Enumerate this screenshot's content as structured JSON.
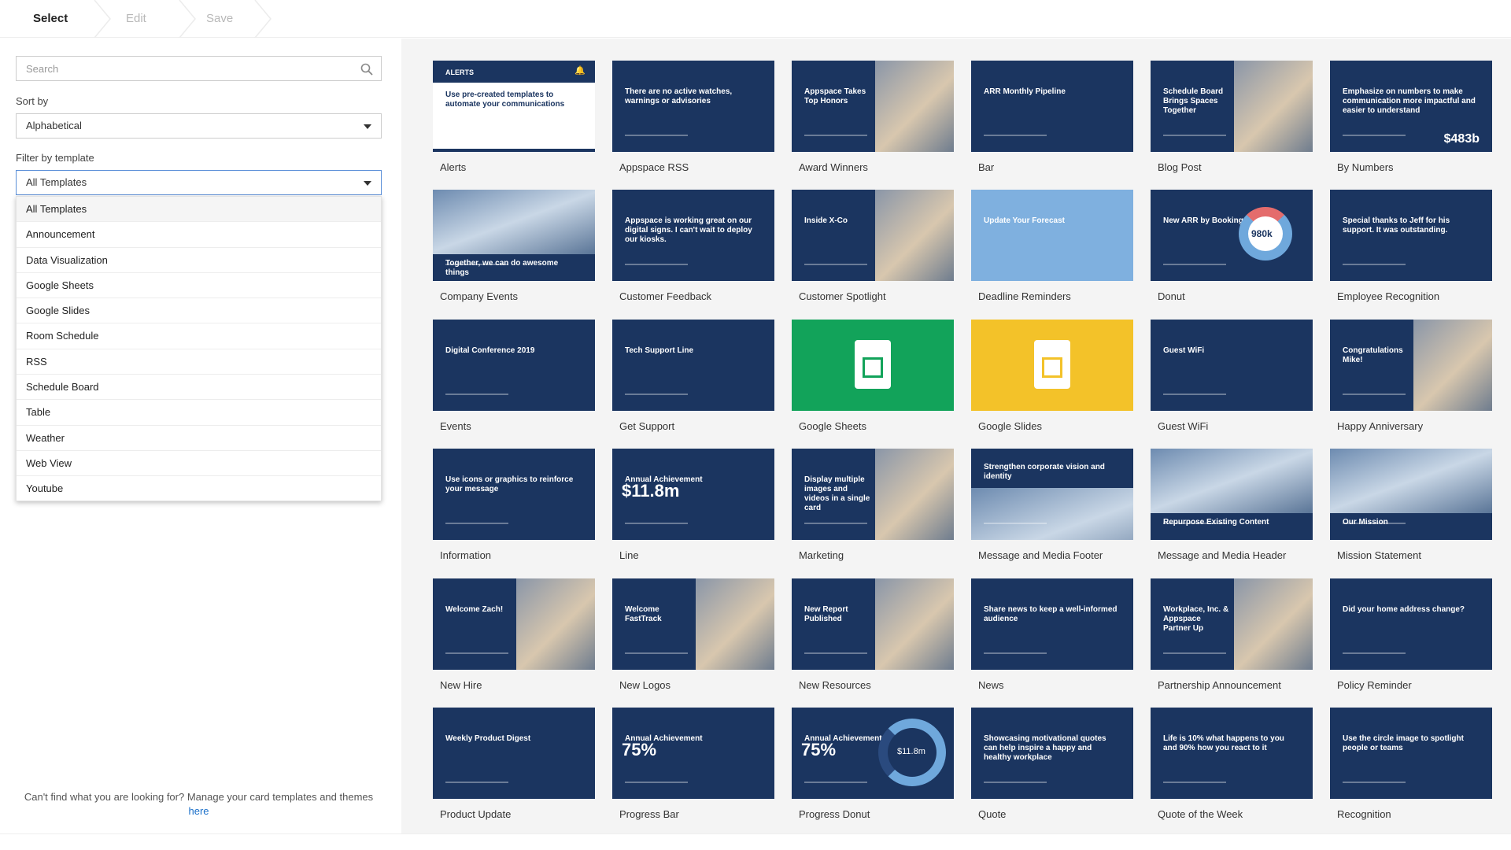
{
  "stepper": {
    "steps": [
      "Select",
      "Edit",
      "Save"
    ]
  },
  "search": {
    "placeholder": "Search"
  },
  "sort": {
    "label": "Sort by",
    "value": "Alphabetical"
  },
  "filter": {
    "label": "Filter by template",
    "value": "All Templates",
    "options": [
      "All Templates",
      "Announcement",
      "Data Visualization",
      "Google Sheets",
      "Google Slides",
      "Room Schedule",
      "RSS",
      "Schedule Board",
      "Table",
      "Weather",
      "Web View",
      "Youtube"
    ]
  },
  "footer": {
    "text": "Can't find what you are looking for? Manage your card templates and themes",
    "link": "here"
  },
  "templates": [
    {
      "name": "Alerts",
      "thumb": {
        "title": "Use pre-created templates to automate your communications",
        "header": "ALERTS"
      }
    },
    {
      "name": "Appspace RSS",
      "thumb": {
        "title": "There are no active watches, warnings or advisories"
      }
    },
    {
      "name": "Award Winners",
      "thumb": {
        "title": "Appspace Takes Top Honors"
      }
    },
    {
      "name": "Bar",
      "thumb": {
        "title": "ARR Monthly Pipeline"
      }
    },
    {
      "name": "Blog Post",
      "thumb": {
        "title": "Schedule Board Brings Spaces Together"
      }
    },
    {
      "name": "By Numbers",
      "thumb": {
        "title": "Emphasize on numbers to make communication more impactful and easier to understand",
        "big": "$483b"
      }
    },
    {
      "name": "Company Events",
      "thumb": {
        "title": "Together, we can do awesome things"
      }
    },
    {
      "name": "Customer Feedback",
      "thumb": {
        "title": "Appspace is working great on our digital signs. I can't wait to deploy our kiosks."
      }
    },
    {
      "name": "Customer Spotlight",
      "thumb": {
        "title": "Inside X-Co"
      }
    },
    {
      "name": "Deadline Reminders",
      "thumb": {
        "title": "Update Your Forecast"
      }
    },
    {
      "name": "Donut",
      "thumb": {
        "title": "New ARR by Booking Type",
        "big": "980k"
      }
    },
    {
      "name": "Employee Recognition",
      "thumb": {
        "title": "Special thanks to Jeff for his support. It was outstanding."
      }
    },
    {
      "name": "Events",
      "thumb": {
        "title": "Digital Conference 2019"
      }
    },
    {
      "name": "Get Support",
      "thumb": {
        "title": "Tech Support Line"
      }
    },
    {
      "name": "Google Sheets",
      "thumb": {
        "title": ""
      }
    },
    {
      "name": "Google Slides",
      "thumb": {
        "title": ""
      }
    },
    {
      "name": "Guest WiFi",
      "thumb": {
        "title": "Guest WiFi"
      }
    },
    {
      "name": "Happy Anniversary",
      "thumb": {
        "title": "Congratulations Mike!"
      }
    },
    {
      "name": "Information",
      "thumb": {
        "title": "Use icons or graphics to reinforce your message"
      }
    },
    {
      "name": "Line",
      "thumb": {
        "title": "Annual Achievement",
        "big": "$11.8m"
      }
    },
    {
      "name": "Marketing",
      "thumb": {
        "title": "Display multiple images and videos in a single card"
      }
    },
    {
      "name": "Message and Media Footer",
      "thumb": {
        "title": "Strengthen corporate vision and identity"
      }
    },
    {
      "name": "Message and Media Header",
      "thumb": {
        "title": "Repurpose Existing Content"
      }
    },
    {
      "name": "Mission Statement",
      "thumb": {
        "title": "Our Mission"
      }
    },
    {
      "name": "New Hire",
      "thumb": {
        "title": "Welcome Zach!"
      }
    },
    {
      "name": "New Logos",
      "thumb": {
        "title": "Welcome FastTrack"
      }
    },
    {
      "name": "New Resources",
      "thumb": {
        "title": "New Report Published"
      }
    },
    {
      "name": "News",
      "thumb": {
        "title": "Share news to keep a well-informed audience"
      }
    },
    {
      "name": "Partnership Announcement",
      "thumb": {
        "title": "Workplace, Inc. & Appspace Partner Up"
      }
    },
    {
      "name": "Policy Reminder",
      "thumb": {
        "title": "Did your home address change?"
      }
    },
    {
      "name": "Product Update",
      "thumb": {
        "title": "Weekly Product Digest"
      }
    },
    {
      "name": "Progress Bar",
      "thumb": {
        "title": "Annual Achievement",
        "big": "75%"
      }
    },
    {
      "name": "Progress Donut",
      "thumb": {
        "title": "Annual Achievement",
        "big": "75%",
        "extra": "$11.8m"
      }
    },
    {
      "name": "Quote",
      "thumb": {
        "title": "Showcasing motivational quotes can help inspire a happy and healthy workplace"
      }
    },
    {
      "name": "Quote of the Week",
      "thumb": {
        "title": "Life is 10% what happens to you and 90% how you react to it"
      }
    },
    {
      "name": "Recognition",
      "thumb": {
        "title": "Use the circle image to spotlight people or teams"
      }
    }
  ],
  "colors": {
    "navy": "#1b3560",
    "green": "#12a35a",
    "yellow": "#f3c229",
    "lightblue": "#7fb0df",
    "accent": "#1a6fc9"
  }
}
